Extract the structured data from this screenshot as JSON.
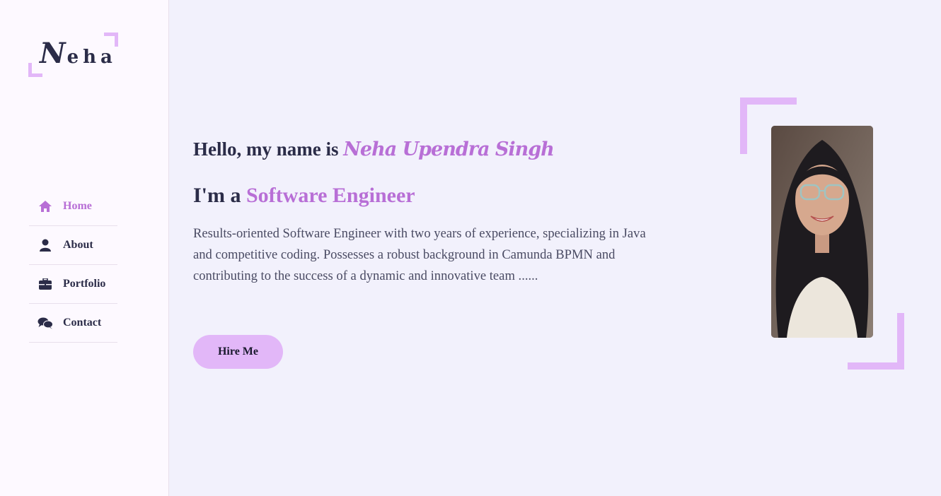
{
  "sidebar": {
    "logo": {
      "initial": "N",
      "rest": "eha"
    },
    "nav": [
      {
        "label": "Home",
        "icon": "home-icon",
        "active": true
      },
      {
        "label": "About",
        "icon": "user-icon",
        "active": false
      },
      {
        "label": "Portfolio",
        "icon": "briefcase-icon",
        "active": false
      },
      {
        "label": "Contact",
        "icon": "chat-icon",
        "active": false
      }
    ]
  },
  "hero": {
    "greeting": "Hello, my name is",
    "name": "Neha Upendra Singh",
    "role_prefix": "I'm a",
    "role": "Software Engineer",
    "description": "Results-oriented Software Engineer with two years of experience, specializing in Java and competitive coding. Possesses a robust background in Camunda BPMN and contributing to the success of a dynamic and innovative team ......",
    "cta_label": "Hire Me"
  },
  "colors": {
    "accent": "#b86fd6",
    "accent_light": "#e2b7f8",
    "text_dark": "#2b2c48",
    "background": "#f2f1fc",
    "sidebar_bg": "#fdf9ff"
  }
}
